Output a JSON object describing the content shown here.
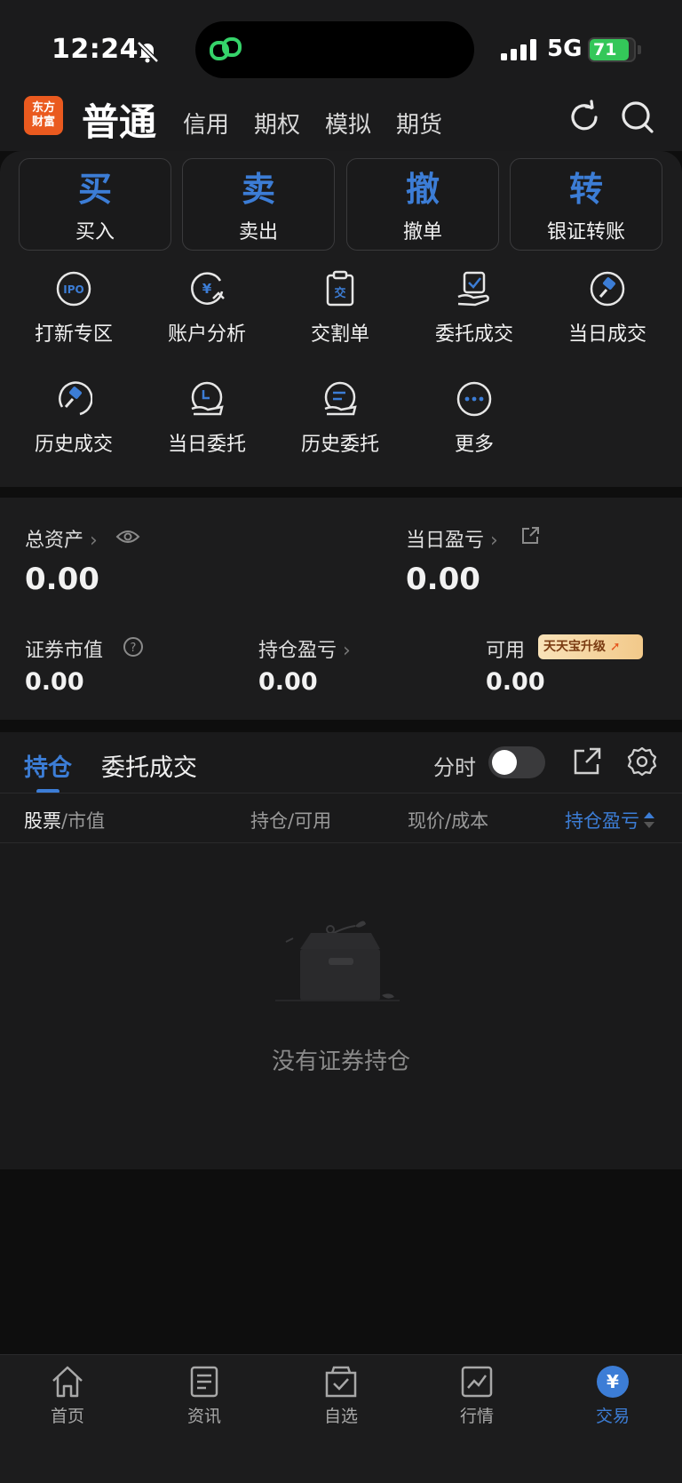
{
  "status_bar": {
    "time": "12:24",
    "network": "5G",
    "battery": "71"
  },
  "header": {
    "logo_text_line1": "东方",
    "logo_text_line2": "财富",
    "account_tabs": [
      {
        "label": "普通",
        "active": true
      },
      {
        "label": "信用"
      },
      {
        "label": "期权"
      },
      {
        "label": "模拟"
      },
      {
        "label": "期货"
      }
    ]
  },
  "quick_actions": [
    {
      "big": "买",
      "small": "买入"
    },
    {
      "big": "卖",
      "small": "卖出"
    },
    {
      "big": "撤",
      "small": "撤单"
    },
    {
      "big": "转",
      "small": "银证转账"
    }
  ],
  "functions": [
    {
      "label": "打新专区",
      "icon": "ipo-icon"
    },
    {
      "label": "账户分析",
      "icon": "account-analysis-icon"
    },
    {
      "label": "交割单",
      "icon": "delivery-slip-icon"
    },
    {
      "label": "委托成交",
      "icon": "order-deal-icon"
    },
    {
      "label": "当日成交",
      "icon": "today-deal-icon"
    },
    {
      "label": "历史成交",
      "icon": "history-deal-icon"
    },
    {
      "label": "当日委托",
      "icon": "today-order-icon"
    },
    {
      "label": "历史委托",
      "icon": "history-order-icon"
    },
    {
      "label": "更多",
      "icon": "more-icon"
    }
  ],
  "assets": {
    "total_label": "总资产",
    "total_value": "0.00",
    "daily_pl_label": "当日盈亏",
    "daily_pl_value": "0.00",
    "market_value_label": "证券市值",
    "market_value": "0.00",
    "holding_pl_label": "持仓盈亏",
    "holding_pl_value": "0.00",
    "available_label": "可用",
    "available_value": "0.00",
    "upgrade_badge": "天天宝升级"
  },
  "holdings": {
    "tabs": [
      "持仓",
      "委托成交"
    ],
    "toggle_label": "分时",
    "columns": {
      "c1_a": "股票",
      "c1_b": "/市值",
      "c2": "持仓/可用",
      "c3": "现价/成本",
      "c4": "持仓盈亏"
    },
    "empty_text": "没有证券持仓"
  },
  "tabbar": [
    {
      "label": "首页",
      "icon": "home-icon"
    },
    {
      "label": "资讯",
      "icon": "news-icon"
    },
    {
      "label": "自选",
      "icon": "watchlist-icon"
    },
    {
      "label": "行情",
      "icon": "market-icon"
    },
    {
      "label": "交易",
      "icon": "trade-icon",
      "active": true
    }
  ],
  "colors": {
    "accent": "#3c7dd6",
    "brand": "#ea5a1f",
    "battery": "#34c759"
  }
}
